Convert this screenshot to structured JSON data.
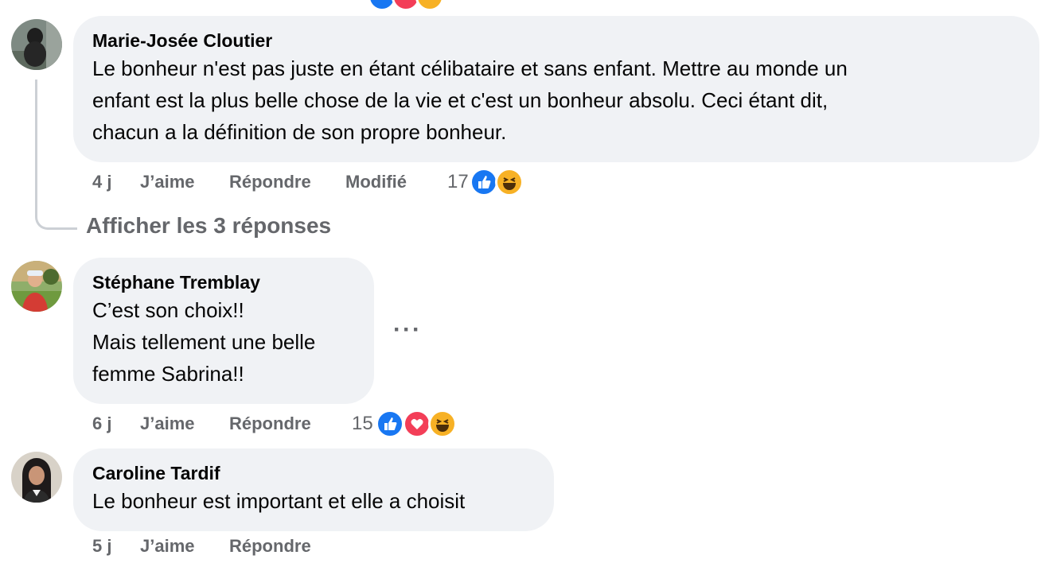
{
  "comments": [
    {
      "author": "Marie-Josée Cloutier",
      "lines": [
        "Le bonheur n'est pas juste en étant célibataire et sans enfant. Mettre au monde un",
        "enfant est la plus belle chose de la vie et c'est un bonheur absolu. Ceci étant dit,",
        "chacun a la définition de son propre bonheur."
      ],
      "time": "4 j",
      "like_label": "J’aime",
      "reply_label": "Répondre",
      "edited_label": "Modifié",
      "reaction_count": "17",
      "reactions": [
        "like-icon",
        "haha-icon"
      ],
      "show_replies": "Afficher les 3 réponses"
    },
    {
      "author": "Stéphane Tremblay",
      "lines": [
        "C’est son choix!!",
        "Mais tellement une belle",
        "femme Sabrina!!"
      ],
      "time": "6 j",
      "like_label": "J’aime",
      "reply_label": "Répondre",
      "reaction_count": "15",
      "reactions": [
        "like-icon",
        "love-icon",
        "haha-icon"
      ],
      "more": "···"
    },
    {
      "author": "Caroline Tardif",
      "lines": [
        "Le bonheur est important et elle a choisit"
      ],
      "time": "5 j",
      "like_label": "J’aime",
      "reply_label": "Répondre"
    }
  ],
  "colors": {
    "bubble": "#f0f2f5",
    "meta": "#65676b",
    "like": "#1877f2",
    "love": "#f33e58",
    "haha": "#f7b125"
  }
}
